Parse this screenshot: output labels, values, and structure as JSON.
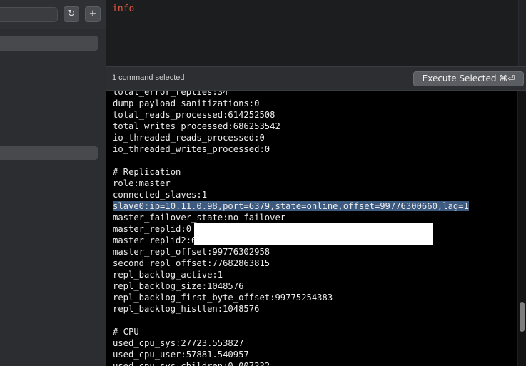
{
  "toolbar": {
    "refresh_icon": "↻",
    "add_icon": "+"
  },
  "editor": {
    "command": "info"
  },
  "status": {
    "selection_text": "1 command selected",
    "execute_label": "Execute Selected ⌘⏎"
  },
  "output": {
    "lines": [
      "total_error_replies:34",
      "dump_payload_sanitizations:0",
      "total_reads_processed:614252508",
      "total_writes_processed:686253542",
      "io_threaded_reads_processed:0",
      "io_threaded_writes_processed:0",
      "",
      "# Replication",
      "role:master",
      "connected_slaves:1",
      "slave0:ip=10.11.0.98,port=6379,state=online,offset=99776300660,lag=1",
      "master_failover_state:no-failover",
      "master_replid:0",
      "master_replid2:0",
      "master_repl_offset:99776302958",
      "second_repl_offset:77682863815",
      "repl_backlog_active:1",
      "repl_backlog_size:1048576",
      "repl_backlog_first_byte_offset:99775254383",
      "repl_backlog_histlen:1048576",
      "",
      "# CPU",
      "used_cpu_sys:27723.553827",
      "used_cpu_user:57881.540957",
      "used_cpu_sys_children:0.007332"
    ],
    "selected_index": 10
  },
  "colors": {
    "command_text": "#e0583c",
    "selection_highlight": "#3d5a80"
  }
}
